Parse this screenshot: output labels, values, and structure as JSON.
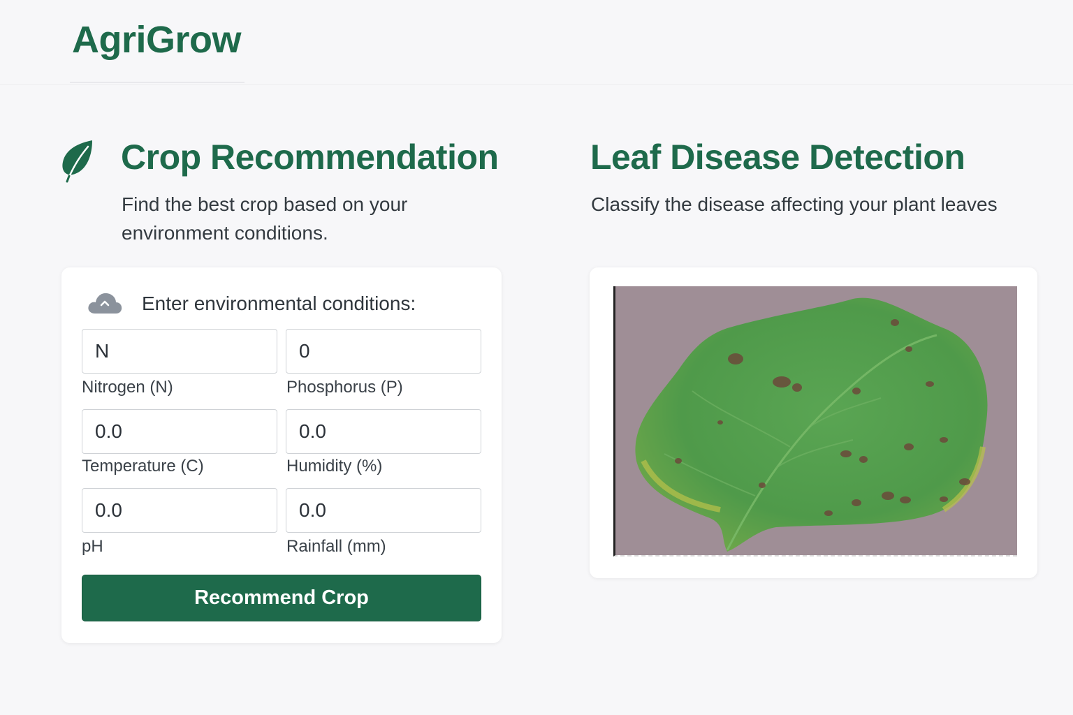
{
  "app": {
    "brand": "AgriGrow"
  },
  "crop_recommendation": {
    "title": "Crop Recommendation",
    "subtitle": "Find the best crop based on your environment conditions.",
    "form_heading": "Enter environmental conditions:",
    "fields": [
      {
        "value": "N",
        "label": "Nitrogen (N)"
      },
      {
        "value": "0",
        "label": "Phosphorus (P)"
      },
      {
        "value": "0.0",
        "label": "Temperature (C)"
      },
      {
        "value": "0.0",
        "label": "Humidity (%)"
      },
      {
        "value": "0.0",
        "label": "pH"
      },
      {
        "value": "0.0",
        "label": "Rainfall (mm)"
      }
    ],
    "button_label": "Recommend Crop"
  },
  "leaf_disease": {
    "title": "Leaf Disease Detection",
    "subtitle": "Classify the disease affecting your plant leaves"
  },
  "icons": {
    "leaf": "leaf-icon",
    "cloud": "cloud-upload-icon"
  },
  "colors": {
    "brand_green": "#1e6a4b",
    "background": "#f7f7f9",
    "card": "#ffffff"
  }
}
